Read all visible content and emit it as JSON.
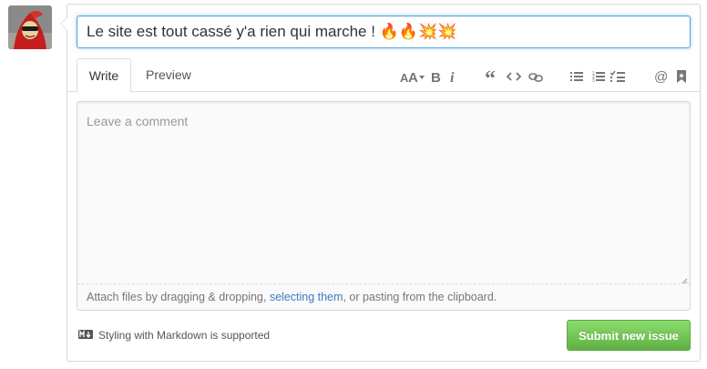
{
  "issue": {
    "title_value": "Le site est tout cassé y'a rien qui marche ! 🔥🔥💥💥"
  },
  "tabs": [
    {
      "label": "Write",
      "active": true
    },
    {
      "label": "Preview",
      "active": false
    }
  ],
  "toolbar": {
    "icons": [
      "text-size-icon",
      "bold-icon",
      "italic-icon",
      "quote-icon",
      "code-icon",
      "link-icon",
      "unordered-list-icon",
      "ordered-list-icon",
      "task-list-icon",
      "mention-icon",
      "bookmark-icon"
    ]
  },
  "comment": {
    "placeholder": "Leave a comment",
    "value": ""
  },
  "attach": {
    "prefix": "Attach files by dragging & dropping, ",
    "link": "selecting them",
    "suffix": ", or pasting from the clipboard."
  },
  "markdown_note": "Styling with Markdown is supported",
  "submit_label": "Submit new issue",
  "colors": {
    "accent_blue": "#51a7e8",
    "link": "#4078c0",
    "submit_green": "#6cc644"
  }
}
